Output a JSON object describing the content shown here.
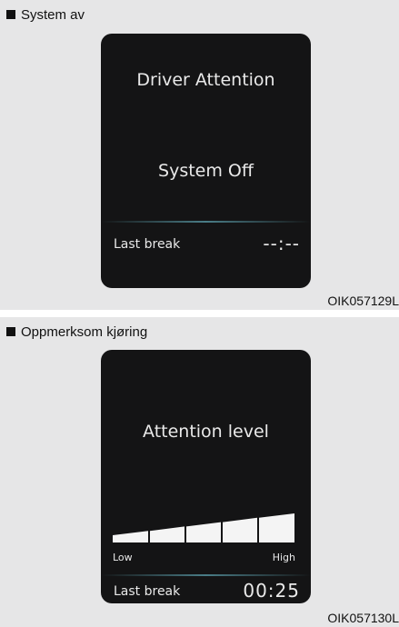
{
  "panels": [
    {
      "caption": "System av",
      "figure_id": "OIK057129L",
      "screen": {
        "title": "Driver Attention",
        "status": "System Off",
        "last_break_label": "Last break",
        "last_break_value": "--:--"
      }
    },
    {
      "caption": "Oppmerksom kjøring",
      "figure_id": "OIK057130L",
      "screen": {
        "title": "Attention level",
        "level_low_label": "Low",
        "level_high_label": "High",
        "attention_level_segments_filled": 5,
        "attention_level_segments_total": 5,
        "last_break_label": "Last break",
        "last_break_value": "00:25"
      }
    }
  ],
  "colors": {
    "panel_background": "#e6e6e7",
    "screen_background": "#141415",
    "screen_text": "#e9e9e9",
    "divider_accent": "#4a7d87"
  }
}
